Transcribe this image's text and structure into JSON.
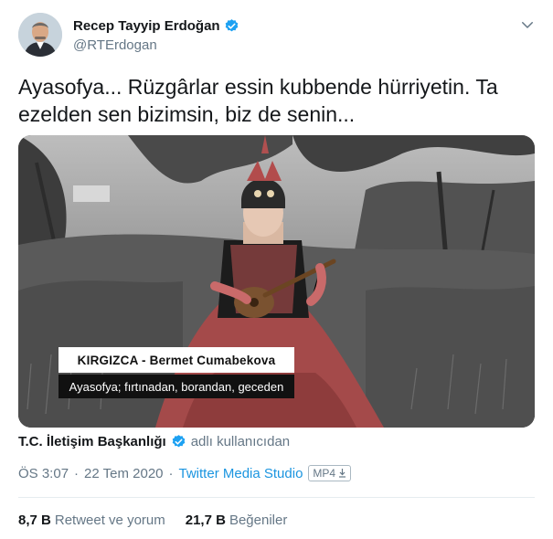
{
  "author": {
    "name": "Recep Tayyip Erdoğan",
    "handle": "@RTErdogan"
  },
  "tweet": {
    "text": "Ayasofya... Rüzgârlar essin kubbende hürriyetin. Ta ezelden sen bizimsin, biz de senin..."
  },
  "media": {
    "caption_title": "KIRGIZCA - Bermet Cumabekova",
    "caption_subtitle": "Ayasofya; fırtınadan, borandan, geceden"
  },
  "source": {
    "name": "T.C. İletişim Başkanlığı",
    "suffix": "adlı kullanıcıdan"
  },
  "meta": {
    "time": "ÖS 3:07",
    "date": "22 Tem 2020",
    "separator": "·",
    "app": "Twitter Media Studio",
    "format_badge": "MP4"
  },
  "stats": {
    "retweets_count": "8,7 B",
    "retweets_label": "Retweet ve yorum",
    "likes_count": "21,7 B",
    "likes_label": "Beğeniler"
  },
  "colors": {
    "link": "#1b95e0",
    "muted": "#657786",
    "verified": "#1da1f2",
    "divider": "#e6ecf0"
  },
  "icons": {
    "verified": "verified-badge-icon",
    "chevron": "chevron-down-icon"
  }
}
